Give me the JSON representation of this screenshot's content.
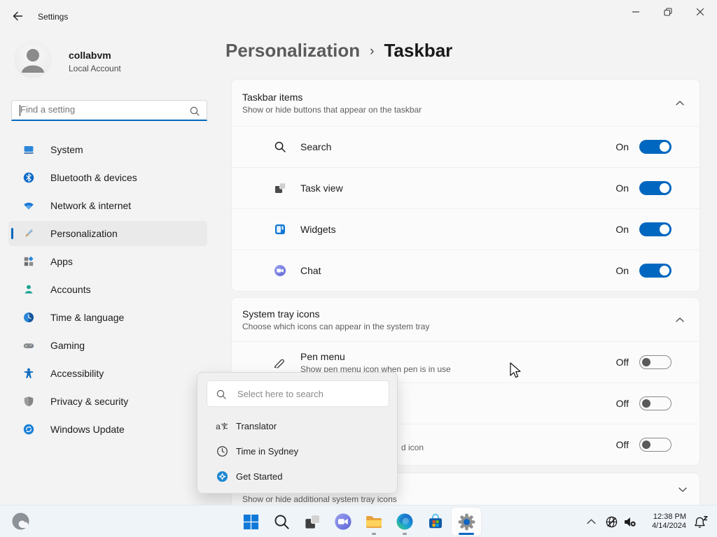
{
  "titlebar": {
    "app_title": "Settings"
  },
  "account": {
    "name": "collabvm",
    "type": "Local Account"
  },
  "sidebar": {
    "search_placeholder": "Find a setting",
    "items": [
      {
        "label": "System"
      },
      {
        "label": "Bluetooth & devices"
      },
      {
        "label": "Network & internet"
      },
      {
        "label": "Personalization"
      },
      {
        "label": "Apps"
      },
      {
        "label": "Accounts"
      },
      {
        "label": "Time & language"
      },
      {
        "label": "Gaming"
      },
      {
        "label": "Accessibility"
      },
      {
        "label": "Privacy & security"
      },
      {
        "label": "Windows Update"
      }
    ]
  },
  "breadcrumb": {
    "parent": "Personalization",
    "separator": "›",
    "current": "Taskbar"
  },
  "taskbar_items_card": {
    "title": "Taskbar items",
    "subtitle": "Show or hide buttons that appear on the taskbar",
    "rows": [
      {
        "label": "Search",
        "state": "On"
      },
      {
        "label": "Task view",
        "state": "On"
      },
      {
        "label": "Widgets",
        "state": "On"
      },
      {
        "label": "Chat",
        "state": "On"
      }
    ]
  },
  "system_tray_card": {
    "title": "System tray icons",
    "subtitle": "Choose which icons can appear in the system tray",
    "rows": [
      {
        "label": "Pen menu",
        "sublabel": "Show pen menu icon when pen is in use",
        "state": "Off"
      },
      {
        "label": "",
        "sublabel": "",
        "state": "Off"
      },
      {
        "label": "",
        "sublabel": "",
        "state": "Off"
      }
    ],
    "covered_subtitle_fragment": "d icon"
  },
  "other_tray_card": {
    "subtitle": "Show or hide additional system tray icons"
  },
  "search_popup": {
    "placeholder": "Select here to search",
    "items": [
      {
        "label": "Translator"
      },
      {
        "label": "Time in Sydney"
      },
      {
        "label": "Get Started"
      }
    ]
  },
  "system_tray": {
    "time": "12:38 PM",
    "date": "4/14/2024"
  },
  "icons": {
    "translator_glyph": "a"
  },
  "colors": {
    "accent": "#0067c0",
    "card_bg": "#fbfbfb",
    "window_bg": "#f3f3f3",
    "taskbar_bg": "#eff4f9"
  }
}
